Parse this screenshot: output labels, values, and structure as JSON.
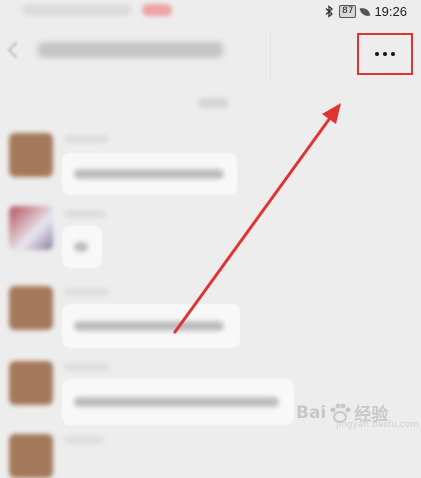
{
  "status_bar": {
    "time": "19:26",
    "battery": "87",
    "icons": [
      "bluetooth-icon",
      "battery-icon",
      "leaf-icon"
    ]
  },
  "header": {
    "more_label": "···",
    "highlight_color": "#e03434"
  },
  "watermark": {
    "brand": "Bai",
    "suffix": "经验",
    "site": "jingyan.baidu.com"
  },
  "colors": {
    "background": "#ededed",
    "bubble": "#f8f8f8",
    "annotation_red": "#e03434"
  }
}
